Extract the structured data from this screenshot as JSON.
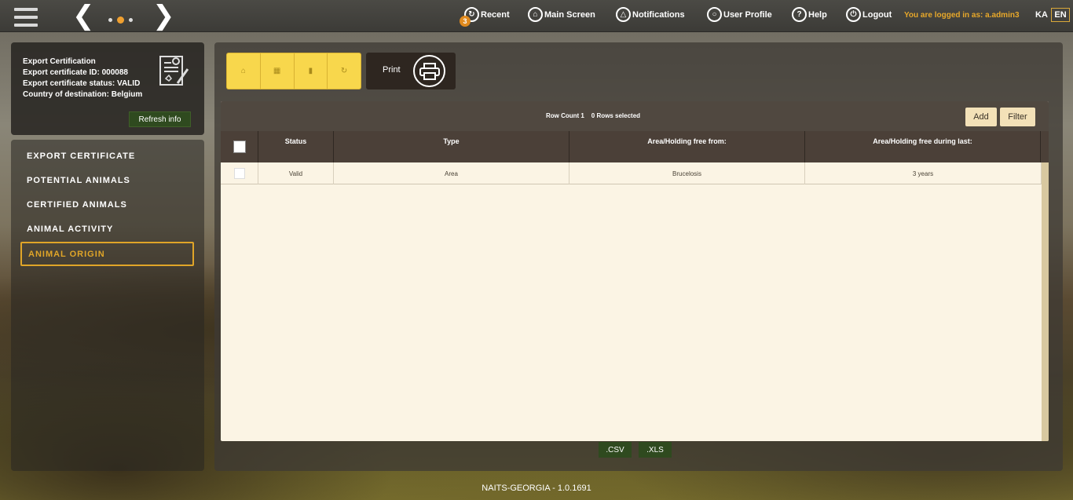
{
  "topbar": {
    "recent": "Recent",
    "recent_badge": "3",
    "main_screen": "Main Screen",
    "notifications": "Notifications",
    "user_profile": "User Profile",
    "help": "Help",
    "logout": "Logout",
    "logged_in": "You are logged in as: a.admin3",
    "lang_ka": "KA",
    "lang_en": "EN"
  },
  "info": {
    "line1": "Export Certification",
    "line2": "Export certificate ID: 000088",
    "line3": "Export certificate status: VALID",
    "line4": "Country of destination: Belgium",
    "refresh": "Refresh info"
  },
  "nav": {
    "items": [
      {
        "label": "EXPORT CERTIFICATE"
      },
      {
        "label": "POTENTIAL ANIMALS"
      },
      {
        "label": "CERTIFIED ANIMALS"
      },
      {
        "label": "ANIMAL ACTIVITY"
      },
      {
        "label": "ANIMAL ORIGIN"
      }
    ],
    "active_index": 4
  },
  "toolbar": {
    "print_label": "Print"
  },
  "grid": {
    "row_count": "Row Count 1",
    "rows_selected": "0 Rows selected",
    "add": "Add",
    "filter": "Filter",
    "columns": [
      "Status",
      "Type",
      "Area/Holding free from:",
      "Area/Holding free during last:"
    ],
    "rows": [
      {
        "status": "Valid",
        "type": "Area",
        "free_from": "Brucelosis",
        "free_during": "3 years"
      }
    ]
  },
  "export": {
    "csv": ".CSV",
    "xls": ".XLS"
  },
  "footer": "NAITS-GEORGIA - 1.0.1691",
  "colors": {
    "accent": "#e0a528",
    "action_yellow": "#f8d74c",
    "green_button": "#2f4a1f",
    "grid_bg": "#fbf4e4"
  }
}
